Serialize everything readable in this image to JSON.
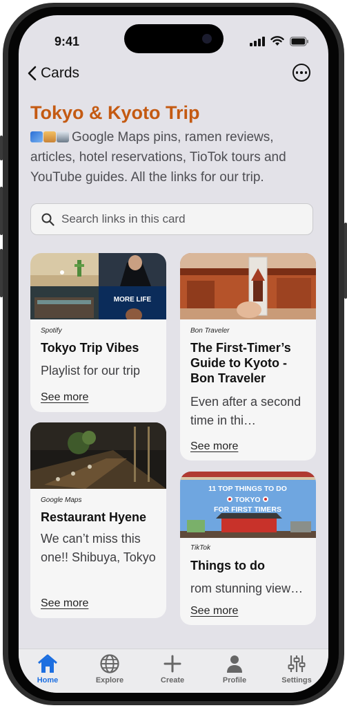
{
  "status": {
    "time": "9:41"
  },
  "nav": {
    "back_label": "Cards"
  },
  "card_title": "Tokyo & Kyoto Trip",
  "card_description": "Google Maps pins, ramen reviews, articles, hotel reservations, TioTok tours and YouTube guides. All the links for our trip.",
  "search": {
    "placeholder": "Search links in this card"
  },
  "links": [
    {
      "source": "Spotify",
      "title": "Tokyo Trip Vibes",
      "description": "Playlist for our trip",
      "see_more": "See more",
      "thumb_text": "MORE LIFE"
    },
    {
      "source": "Google Maps",
      "title": "Restaurant Hyene",
      "description": "We can’t miss this one!! Shibuya, Tokyo",
      "see_more": "See more"
    },
    {
      "source": "Bon Traveler",
      "title": "The First-Timer’s Guide to Kyoto - Bon Traveler",
      "description": "Even after a second time in thi…",
      "see_more": "See more"
    },
    {
      "source": "TikTok",
      "title": "Things to do",
      "description": "rom stunning view…",
      "see_more": "See more",
      "thumb_lines": [
        "11 TOP THINGS TO DO",
        "TOKYO",
        "FOR FIRST TIMERS"
      ]
    }
  ],
  "tabs": [
    {
      "label": "Home",
      "icon": "home-icon",
      "active": true
    },
    {
      "label": "Explore",
      "icon": "globe-icon",
      "active": false
    },
    {
      "label": "Create",
      "icon": "plus-icon",
      "active": false
    },
    {
      "label": "Profile",
      "icon": "person-icon",
      "active": false
    },
    {
      "label": "Settings",
      "icon": "sliders-icon",
      "active": false
    }
  ],
  "colors": {
    "accent": "#c45a12",
    "active_tab": "#1d6fe0",
    "screen_bg": "#e3e2e8"
  }
}
